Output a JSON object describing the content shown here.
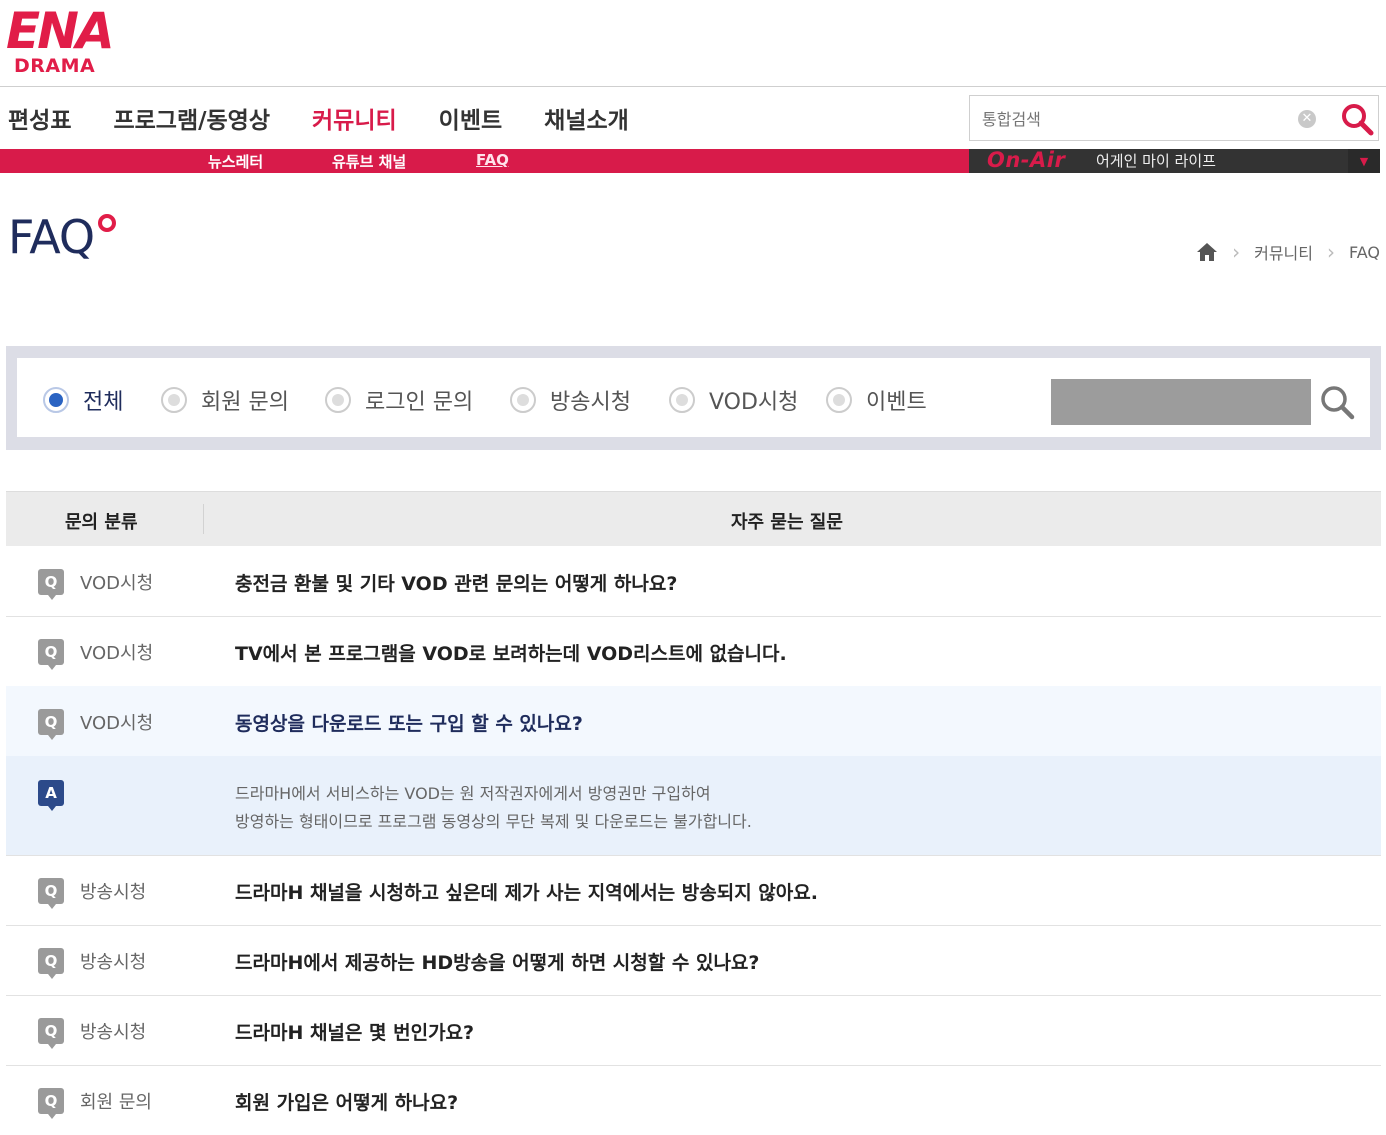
{
  "logo": {
    "brand": "ENA",
    "sub": "DRAMA"
  },
  "nav": {
    "items": [
      "편성표",
      "프로그램/동영상",
      "커뮤니티",
      "이벤트",
      "채널소개"
    ],
    "active_index": 2,
    "sub_items": [
      "뉴스레터",
      "유튜브 채널",
      "FAQ"
    ],
    "sub_active_index": 2
  },
  "search": {
    "placeholder": "통합검색",
    "clear_icon": "clear-icon",
    "go_icon": "search-icon"
  },
  "onair": {
    "tag": "On-Air",
    "program": "어게인 마이 라이프"
  },
  "page": {
    "title": "FAQ"
  },
  "breadcrumb": {
    "items": [
      "커뮤니티",
      "FAQ"
    ]
  },
  "filter": {
    "options": [
      "전체",
      "회원 문의",
      "로그인 문의",
      "방송시청",
      "VOD시청",
      "이벤트"
    ],
    "selected_index": 0
  },
  "table": {
    "headers": [
      "문의 분류",
      "자주 묻는 질문"
    ],
    "q_badge": "Q",
    "a_badge": "A",
    "rows": [
      {
        "category": "VOD시청",
        "question": "충전금 환불 및 기타 VOD 관련 문의는 어떻게 하나요?"
      },
      {
        "category": "VOD시청",
        "question": "TV에서 본 프로그램을 VOD로 보려하는데 VOD리스트에 없습니다."
      },
      {
        "category": "VOD시청",
        "question": "동영상을 다운로드 또는 구입 할 수 있나요?"
      },
      {
        "category": "방송시청",
        "question": "드라마H 채널을 시청하고 싶은데 제가 사는 지역에서는 방송되지 않아요."
      },
      {
        "category": "방송시청",
        "question": "드라마H에서 제공하는 HD방송을 어떻게 하면 시청할 수 있나요?"
      },
      {
        "category": "방송시청",
        "question": "드라마H 채널은 몇 번인가요?"
      },
      {
        "category": "회원 문의",
        "question": "회원 가입은 어떻게 하나요?"
      }
    ],
    "open_answer": {
      "line1": "드라마H에서 서비스하는 VOD는 원 저작권자에게서 방영권만 구입하여",
      "line2": "방영하는 형태이므로 프로그램 동영상의 무단 복제 및 다운로드는 불가합니다."
    }
  },
  "colors": {
    "accent": "#d81b4a",
    "navy": "#1f2c5c",
    "answer_bg": "#e9f1fb"
  }
}
